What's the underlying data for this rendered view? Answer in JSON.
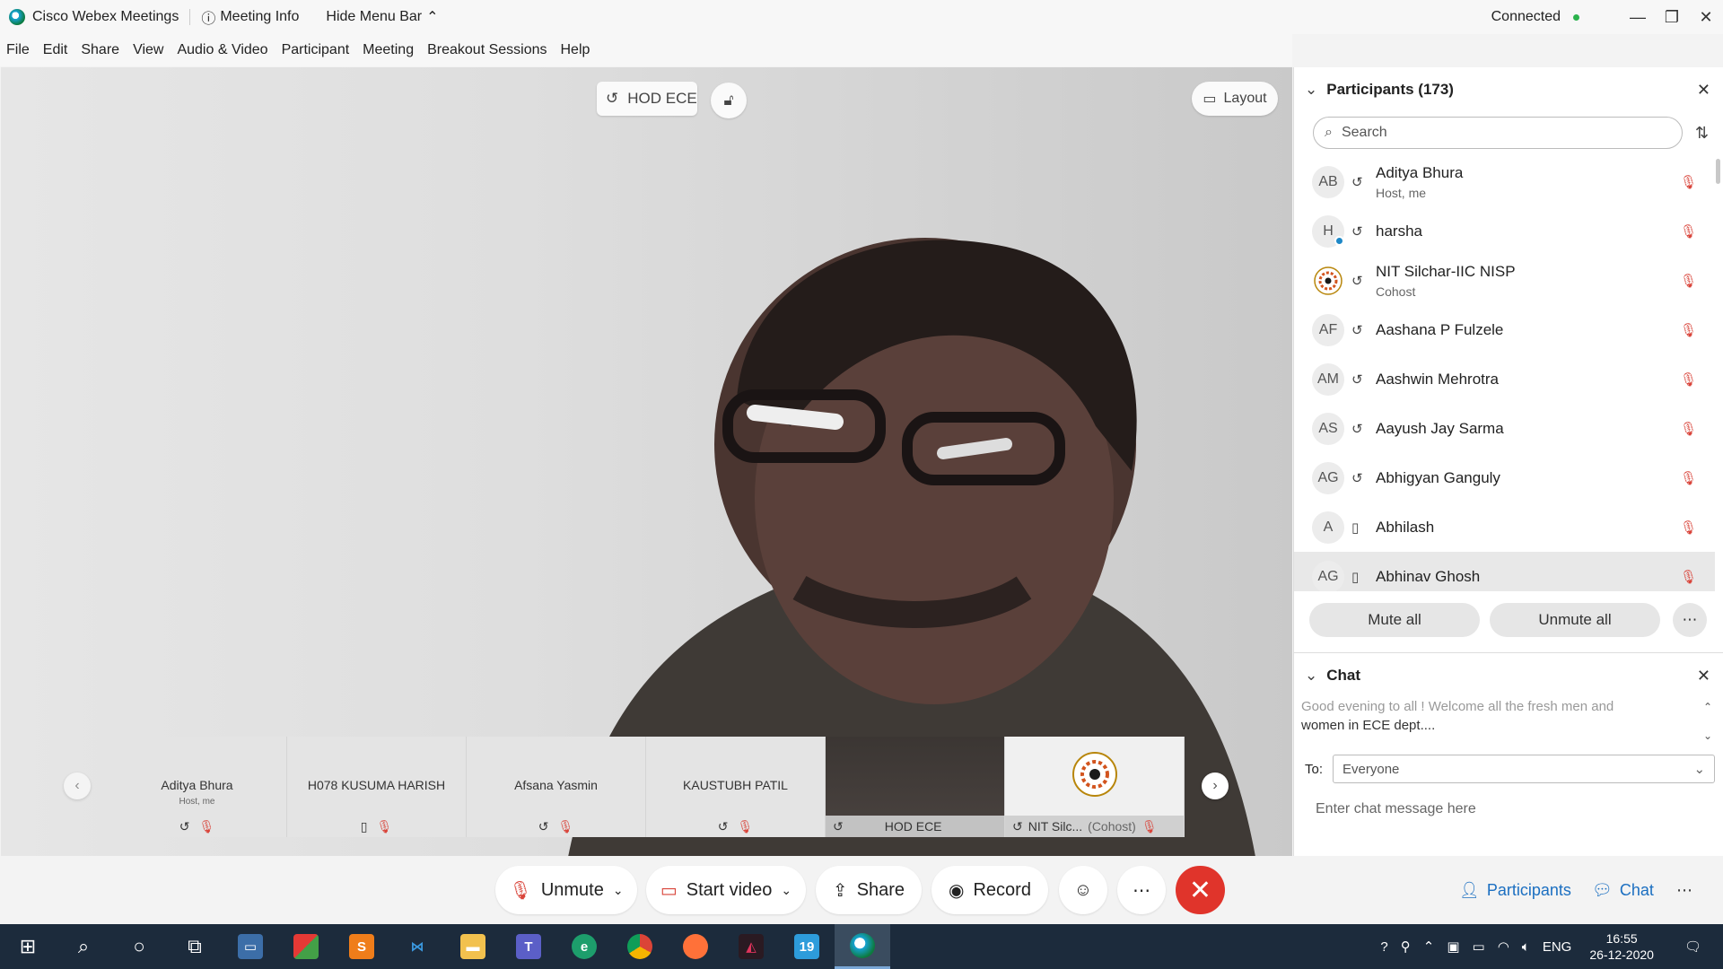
{
  "titlebar": {
    "app_title": "Cisco Webex Meetings",
    "meeting_info": "Meeting Info",
    "hide_menu_bar": "Hide Menu Bar",
    "status": "Connected",
    "status_color": "#2bb24c"
  },
  "menu": [
    "File",
    "Edit",
    "Share",
    "View",
    "Audio & Video",
    "Participant",
    "Meeting",
    "Breakout Sessions",
    "Help"
  ],
  "stage": {
    "active_speaker_label": "HOD ECE",
    "layout_label": "Layout"
  },
  "thumbnails": [
    {
      "name": "Aditya Bhura",
      "sub": "Host, me"
    },
    {
      "name": "H078 KUSUMA HARISH",
      "sub": ""
    },
    {
      "name": "Afsana Yasmin",
      "sub": ""
    },
    {
      "name": "KAUSTUBH PATIL",
      "sub": ""
    },
    {
      "name": "HOD ECE",
      "sub": ""
    },
    {
      "name": "NIT Silc...",
      "sub": "(Cohost)"
    }
  ],
  "participants_panel": {
    "title": "Participants (173)",
    "search_placeholder": "Search",
    "items": [
      {
        "initials": "AB",
        "name": "Aditya Bhura",
        "role": "Host, me",
        "device": "audio"
      },
      {
        "initials": "H",
        "name": "harsha",
        "role": "",
        "device": "audio"
      },
      {
        "initials": "",
        "name": "NIT Silchar-IIC NISP",
        "role": "Cohost",
        "device": "audio"
      },
      {
        "initials": "AF",
        "name": "Aashana P Fulzele",
        "role": "",
        "device": "audio"
      },
      {
        "initials": "AM",
        "name": "Aashwin Mehrotra",
        "role": "",
        "device": "audio"
      },
      {
        "initials": "AS",
        "name": "Aayush Jay Sarma",
        "role": "",
        "device": "audio"
      },
      {
        "initials": "AG",
        "name": "Abhigyan Ganguly",
        "role": "",
        "device": "audio"
      },
      {
        "initials": "A",
        "name": "Abhilash",
        "role": "",
        "device": "phone"
      },
      {
        "initials": "AG",
        "name": "Abhinav Ghosh",
        "role": "",
        "device": "phone"
      }
    ],
    "mute_all": "Mute all",
    "unmute_all": "Unmute all"
  },
  "chat_panel": {
    "title": "Chat",
    "message_line1": "Good evening to all ! Welcome all the fresh men and",
    "message_line2": "women in ECE dept....",
    "to_label": "To:",
    "to_value": "Everyone",
    "input_placeholder": "Enter chat message here"
  },
  "controls": {
    "unmute": "Unmute",
    "start_video": "Start video",
    "share": "Share",
    "record": "Record",
    "participants": "Participants",
    "chat": "Chat"
  },
  "taskbar": {
    "language": "ENG",
    "time": "16:55",
    "date": "26-12-2020"
  },
  "colors": {
    "accent_blue": "#1b6fc1",
    "muted_red": "#d9443a",
    "end_meeting_red": "#e0342b",
    "taskbar_bg": "#1c2b3c"
  }
}
